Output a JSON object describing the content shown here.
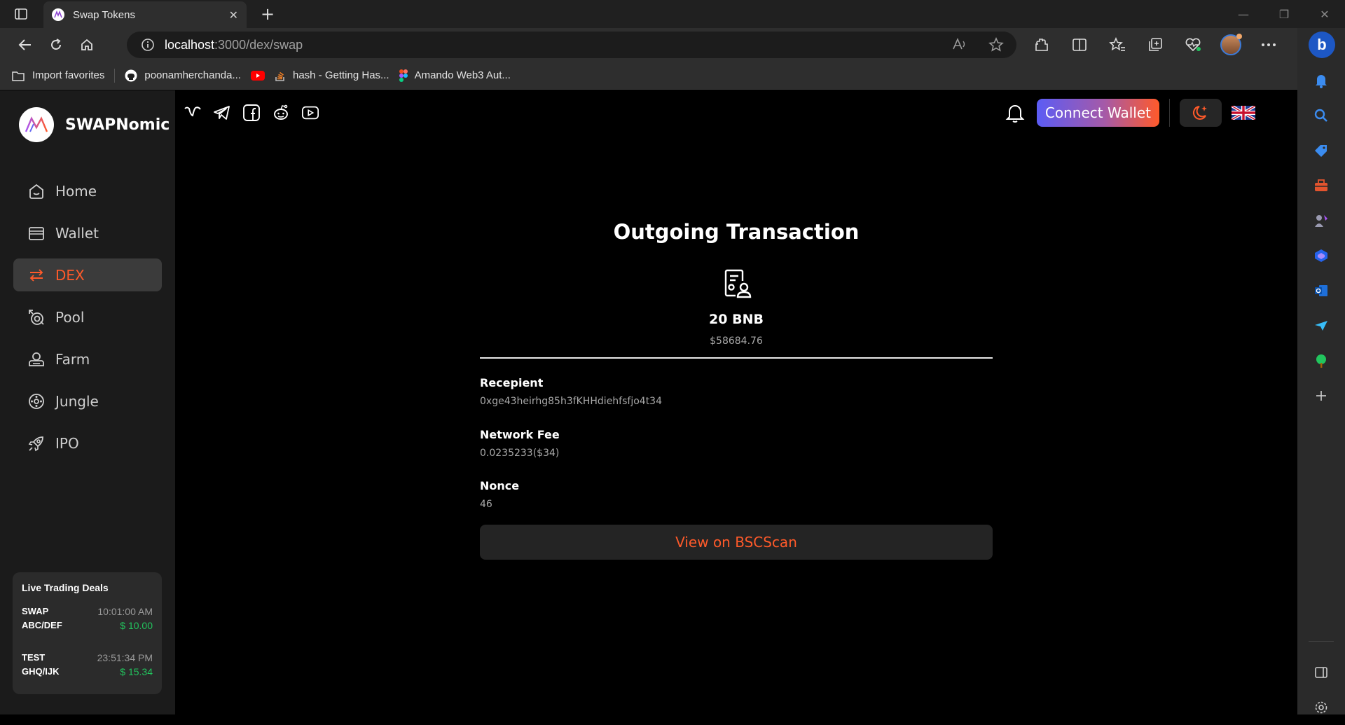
{
  "browser": {
    "tab_title": "Swap Tokens",
    "url_host": "localhost",
    "url_path": ":3000/dex/swap",
    "favorites": [
      {
        "label": "Import favorites",
        "icon": "folder-import-icon"
      },
      {
        "label": "poonamherchanda...",
        "icon": "github-icon"
      },
      {
        "label": "",
        "icon": "youtube-icon"
      },
      {
        "label": "hash - Getting Has...",
        "icon": "stackoverflow-icon"
      },
      {
        "label": "Amando Web3 Aut...",
        "icon": "figma-icon"
      }
    ]
  },
  "app": {
    "brand": "SWAPNomic",
    "menu": [
      {
        "label": "Home",
        "icon": "home-icon",
        "active": false
      },
      {
        "label": "Wallet",
        "icon": "wallet-icon",
        "active": false
      },
      {
        "label": "DEX",
        "icon": "swap-arrows-icon",
        "active": true
      },
      {
        "label": "Pool",
        "icon": "pool-icon",
        "active": false
      },
      {
        "label": "Farm",
        "icon": "farm-icon",
        "active": false
      },
      {
        "label": "Jungle",
        "icon": "jungle-icon",
        "active": false
      },
      {
        "label": "IPO",
        "icon": "rocket-icon",
        "active": false
      }
    ],
    "live_deals": {
      "title": "Live Trading Deals",
      "deals": [
        {
          "type": "SWAP",
          "pair": "ABC/DEF",
          "time": "10:01:00 AM",
          "price": "$ 10.00"
        },
        {
          "type": "TEST",
          "pair": "GHQ/IJK",
          "time": "23:51:34 PM",
          "price": "$ 15.34"
        }
      ]
    },
    "header": {
      "connect_label": "Connect Wallet"
    },
    "transaction": {
      "title": "Outgoing Transaction",
      "amount": "20 BNB",
      "usd_value": "$58684.76",
      "recipient_label": "Recepient",
      "recipient_value": "0xge43heirhg85h3fKHHdiehfsfjo4t34",
      "fee_label": "Network Fee",
      "fee_value": "0.0235233($34)",
      "nonce_label": "Nonce",
      "nonce_value": "46",
      "view_button": "View on BSCScan"
    }
  },
  "colors": {
    "accent": "#ff5a2a",
    "positive": "#22c55e",
    "gradient_start": "#5b5cf5"
  }
}
